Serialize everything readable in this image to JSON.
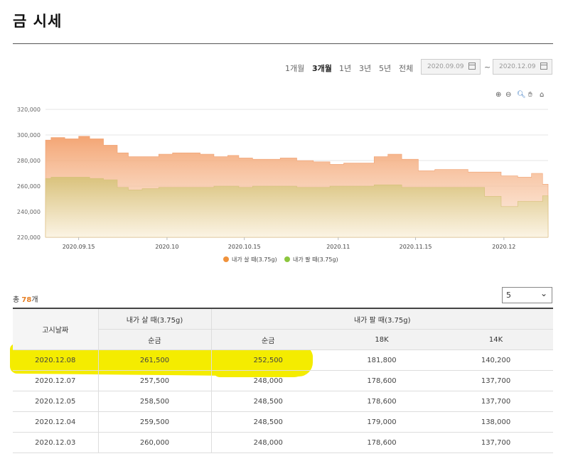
{
  "page": {
    "title": "금 시세"
  },
  "periods": [
    {
      "label": "1개월",
      "active": false
    },
    {
      "label": "3개월",
      "active": true
    },
    {
      "label": "1년",
      "active": false
    },
    {
      "label": "3년",
      "active": false
    },
    {
      "label": "5년",
      "active": false
    },
    {
      "label": "전체",
      "active": false
    }
  ],
  "date_range": {
    "start": "2020.09.09",
    "end": "2020.12.09",
    "separator": "~"
  },
  "chart_tools": {
    "zoom_in": "zoom-in-icon",
    "zoom_out": "zoom-out-icon",
    "magnify": "magnify-icon",
    "pan": "pan-hand-icon",
    "home": "home-icon"
  },
  "chart_data": {
    "type": "area",
    "ylim": [
      220000,
      320000
    ],
    "y_ticks": [
      "320,000",
      "300,000",
      "280,000",
      "260,000",
      "240,000",
      "220,000"
    ],
    "x_tick_labels": [
      "2020.09.15",
      "2020.10",
      "2020.10.15",
      "2020.11",
      "2020.11.15",
      "2020.12"
    ],
    "x_tick_dates": [
      "2020-09-15",
      "2020-10-01",
      "2020-10-15",
      "2020-11-01",
      "2020-11-15",
      "2020-12-01"
    ],
    "x_range": [
      "2020-09-09",
      "2020-12-09"
    ],
    "grid": true,
    "legend_placement": "bottom",
    "series": [
      {
        "name": "내가 살 때(3.75g)",
        "color": "#f0a070",
        "x": [
          "2020-09-09",
          "2020-09-11",
          "2020-09-14",
          "2020-09-16",
          "2020-09-18",
          "2020-09-21",
          "2020-09-23",
          "2020-09-25",
          "2020-09-28",
          "2020-10-01",
          "2020-10-03",
          "2020-10-06",
          "2020-10-08",
          "2020-10-11",
          "2020-10-13",
          "2020-10-15",
          "2020-10-18",
          "2020-10-20",
          "2020-10-23",
          "2020-10-26",
          "2020-10-29",
          "2020-11-01",
          "2020-11-03",
          "2020-11-06",
          "2020-11-09",
          "2020-11-11",
          "2020-11-14",
          "2020-11-17",
          "2020-11-20",
          "2020-11-23",
          "2020-11-26",
          "2020-11-29",
          "2020-12-02",
          "2020-12-05",
          "2020-12-07",
          "2020-12-09"
        ],
        "values": [
          296000,
          298000,
          297000,
          299000,
          297000,
          292000,
          286000,
          283000,
          283000,
          285000,
          286000,
          286000,
          285000,
          283000,
          284000,
          282000,
          281000,
          281000,
          282000,
          280000,
          279000,
          277000,
          278000,
          278000,
          283000,
          285000,
          281000,
          272000,
          273000,
          273000,
          271000,
          271000,
          268000,
          267000,
          270000,
          261500
        ]
      },
      {
        "name": "내가 팔 때(3.75g)",
        "color": "#d6c07a",
        "x": [
          "2020-09-09",
          "2020-09-11",
          "2020-09-14",
          "2020-09-16",
          "2020-09-18",
          "2020-09-21",
          "2020-09-23",
          "2020-09-25",
          "2020-09-28",
          "2020-10-01",
          "2020-10-03",
          "2020-10-06",
          "2020-10-08",
          "2020-10-11",
          "2020-10-13",
          "2020-10-15",
          "2020-10-18",
          "2020-10-20",
          "2020-10-23",
          "2020-10-26",
          "2020-10-29",
          "2020-11-01",
          "2020-11-03",
          "2020-11-06",
          "2020-11-09",
          "2020-11-11",
          "2020-11-14",
          "2020-11-17",
          "2020-11-20",
          "2020-11-23",
          "2020-11-26",
          "2020-11-29",
          "2020-12-02",
          "2020-12-05",
          "2020-12-07",
          "2020-12-09"
        ],
        "values": [
          266000,
          267000,
          267000,
          267000,
          266000,
          265000,
          259000,
          257000,
          258000,
          259000,
          259000,
          259000,
          259000,
          260000,
          260000,
          259000,
          260000,
          260000,
          260000,
          259000,
          259000,
          260000,
          260000,
          260000,
          261000,
          261000,
          259000,
          259000,
          259000,
          259000,
          259000,
          252000,
          244000,
          248000,
          248000,
          252500
        ]
      }
    ]
  },
  "table": {
    "total_prefix": "총 ",
    "total_count": "78",
    "total_suffix": "개",
    "page_size": "5",
    "headers": {
      "date": "고시날짜",
      "buy": "내가 살 때(3.75g)",
      "sell": "내가 팔 때(3.75g)",
      "buy_pure": "순금",
      "sell_pure": "순금",
      "sell_18k": "18K",
      "sell_14k": "14K"
    },
    "rows": [
      {
        "date": "2020.12.08",
        "buy_pure": "261,500",
        "sell_pure": "252,500",
        "k18": "181,800",
        "k14": "140,200"
      },
      {
        "date": "2020.12.07",
        "buy_pure": "257,500",
        "sell_pure": "248,000",
        "k18": "178,600",
        "k14": "137,700"
      },
      {
        "date": "2020.12.05",
        "buy_pure": "258,500",
        "sell_pure": "248,500",
        "k18": "178,600",
        "k14": "137,700"
      },
      {
        "date": "2020.12.04",
        "buy_pure": "259,500",
        "sell_pure": "248,500",
        "k18": "179,000",
        "k14": "138,000"
      },
      {
        "date": "2020.12.03",
        "buy_pure": "260,000",
        "sell_pure": "248,000",
        "k18": "178,600",
        "k14": "137,700"
      }
    ],
    "highlight_color": "#f4ec00"
  }
}
